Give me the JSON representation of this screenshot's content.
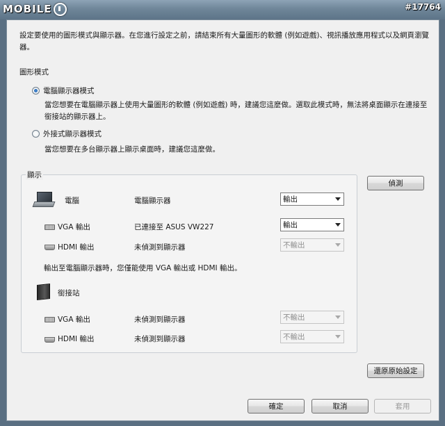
{
  "watermark": {
    "logo_text": "MOBILE",
    "post_id": "#17764"
  },
  "intro": "設定要使用的圖形模式與顯示器。在您進行設定之前，請結束所有大量圖形的軟體 (例如遊戲)、視訊播放應用程式以及網頁瀏覽器。",
  "graphics_mode": {
    "label": "圖形模式",
    "options": [
      {
        "label": "電腦顯示器模式",
        "checked": true,
        "description": "當您想要在電腦顯示器上使用大量圖形的軟體 (例如遊戲) 時，建議您這麼做。選取此模式時，無法將桌面顯示在連接至銜接站的顯示器上。"
      },
      {
        "label": "外接式顯示器模式",
        "checked": false,
        "description": "當您想要在多台顯示器上顯示桌面時，建議您這麼做。"
      }
    ]
  },
  "display_group": {
    "title": "顯示",
    "computer": {
      "name": "電腦",
      "rows": [
        {
          "name": "",
          "status": "電腦顯示器",
          "select": "輸出",
          "enabled": true
        },
        {
          "name": "VGA 輸出",
          "status": "已連接至 ASUS VW227",
          "select": "輸出",
          "enabled": true
        },
        {
          "name": "HDMI 輸出",
          "status": "未偵測到顯示器",
          "select": "不輸出",
          "enabled": false
        }
      ]
    },
    "note": "輸出至電腦顯示器時，您僅能使用 VGA 輸出或 HDMI 輸出。",
    "dock": {
      "name": "銜接站",
      "rows": [
        {
          "name": "VGA 輸出",
          "status": "未偵測到顯示器",
          "select": "不輸出",
          "enabled": false
        },
        {
          "name": "HDMI 輸出",
          "status": "未偵測到顯示器",
          "select": "不輸出",
          "enabled": false
        }
      ]
    }
  },
  "buttons": {
    "detect": "偵測",
    "restore": "還原原始設定",
    "ok": "確定",
    "cancel": "取消",
    "apply": "套用"
  }
}
